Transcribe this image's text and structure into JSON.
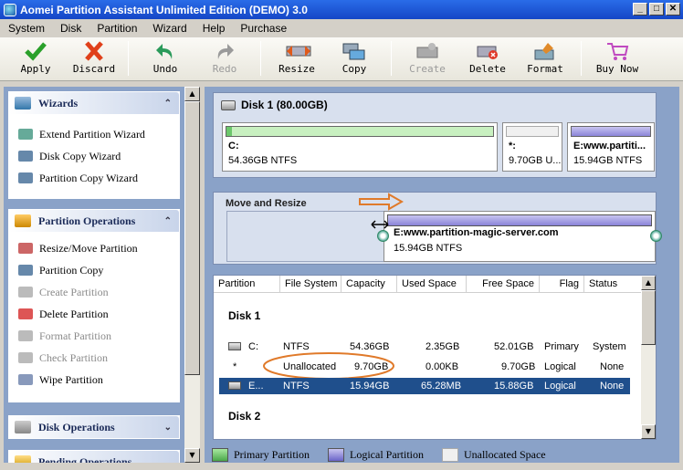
{
  "window": {
    "title": "Aomei Partition Assistant Unlimited Edition (DEMO) 3.0",
    "btn_min": "_",
    "btn_max": "□",
    "btn_close": "✕"
  },
  "menu": [
    "System",
    "Disk",
    "Partition",
    "Wizard",
    "Help",
    "Purchase"
  ],
  "toolbar": {
    "apply": "Apply",
    "discard": "Discard",
    "undo": "Undo",
    "redo": "Redo",
    "resize": "Resize",
    "copy": "Copy",
    "create": "Create",
    "delete": "Delete",
    "format": "Format",
    "buy": "Buy Now"
  },
  "left": {
    "wizards": {
      "title": "Wizards",
      "chevron": "⌃",
      "items": [
        "Extend Partition Wizard",
        "Disk Copy Wizard",
        "Partition Copy Wizard"
      ]
    },
    "partition_ops": {
      "title": "Partition Operations",
      "chevron": "⌃",
      "items": [
        "Resize/Move Partition",
        "Partition Copy",
        "Create Partition",
        "Delete Partition",
        "Format Partition",
        "Check Partition",
        "Wipe Partition"
      ]
    },
    "disk_ops": {
      "title": "Disk Operations",
      "chevron": "⌄"
    },
    "pending": {
      "title": "Pending Operations"
    }
  },
  "disk_map": {
    "title": "Disk 1 (80.00GB)",
    "partitions": [
      {
        "name": "C:",
        "size": "54.36GB NTFS"
      },
      {
        "name": "*:",
        "size": "9.70GB U..."
      },
      {
        "name": "E:www.partiti...",
        "size": "15.94GB NTFS"
      }
    ]
  },
  "move_resize": {
    "title": "Move and Resize",
    "name": "E:www.partition-magic-server.com",
    "size": "15.94GB NTFS"
  },
  "list": {
    "headers": [
      "Partition",
      "File System",
      "Capacity",
      "Used Space",
      "Free Space",
      "Flag",
      "Status"
    ],
    "disk1": "Disk 1",
    "disk2": "Disk 2",
    "rows": [
      {
        "partition": "C:",
        "fs": "NTFS",
        "cap": "54.36GB",
        "used": "2.35GB",
        "free": "52.01GB",
        "flag": "Primary",
        "status": "System"
      },
      {
        "partition": "*",
        "fs": "Unallocated",
        "cap": "9.70GB",
        "used": "0.00KB",
        "free": "9.70GB",
        "flag": "Logical",
        "status": "None"
      },
      {
        "partition": "E...",
        "fs": "NTFS",
        "cap": "15.94GB",
        "used": "65.28MB",
        "free": "15.88GB",
        "flag": "Logical",
        "status": "None"
      }
    ]
  },
  "legend": {
    "primary": "Primary Partition",
    "logical": "Logical Partition",
    "unalloc": "Unallocated Space"
  },
  "colors": {
    "primary": "#6cc86c",
    "logical": "#8a84d8",
    "unallocated": "#f0f0f0",
    "selection": "#1f4f8c",
    "annotation": "#e07a2a"
  }
}
